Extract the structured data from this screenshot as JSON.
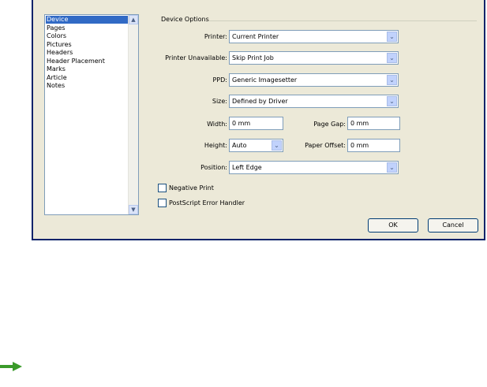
{
  "categories": [
    "Device",
    "Pages",
    "Colors",
    "Pictures",
    "Headers",
    "Header Placement",
    "Marks",
    "Article",
    "Notes"
  ],
  "selected_category": "Device",
  "section_title": "Device Options",
  "fields": {
    "printer": {
      "label": "Printer:",
      "value": "Current Printer"
    },
    "printer_unavailable": {
      "label": "Printer Unavailable:",
      "value": "Skip Print Job"
    },
    "ppd": {
      "label": "PPD:",
      "value": "Generic Imagesetter"
    },
    "size": {
      "label": "Size:",
      "value": "Defined by Driver"
    },
    "width": {
      "label": "Width:",
      "value": "0 mm"
    },
    "page_gap": {
      "label": "Page Gap:",
      "value": "0 mm"
    },
    "height": {
      "label": "Height:",
      "value": "Auto"
    },
    "paper_offset": {
      "label": "Paper Offset:",
      "value": "0 mm"
    },
    "position": {
      "label": "Position:",
      "value": "Left Edge"
    }
  },
  "checkboxes": {
    "negative_print": {
      "label": "Negative Print",
      "checked": false
    },
    "postscript_error_handler": {
      "label": "PostScript Error Handler",
      "checked": false
    }
  },
  "buttons": {
    "ok": "OK",
    "cancel": "Cancel"
  },
  "colors": {
    "selection": "#316ac5",
    "dialog_bg": "#ece9d8",
    "window_border": "#0a246a",
    "arrow": "#3a9a2a"
  }
}
